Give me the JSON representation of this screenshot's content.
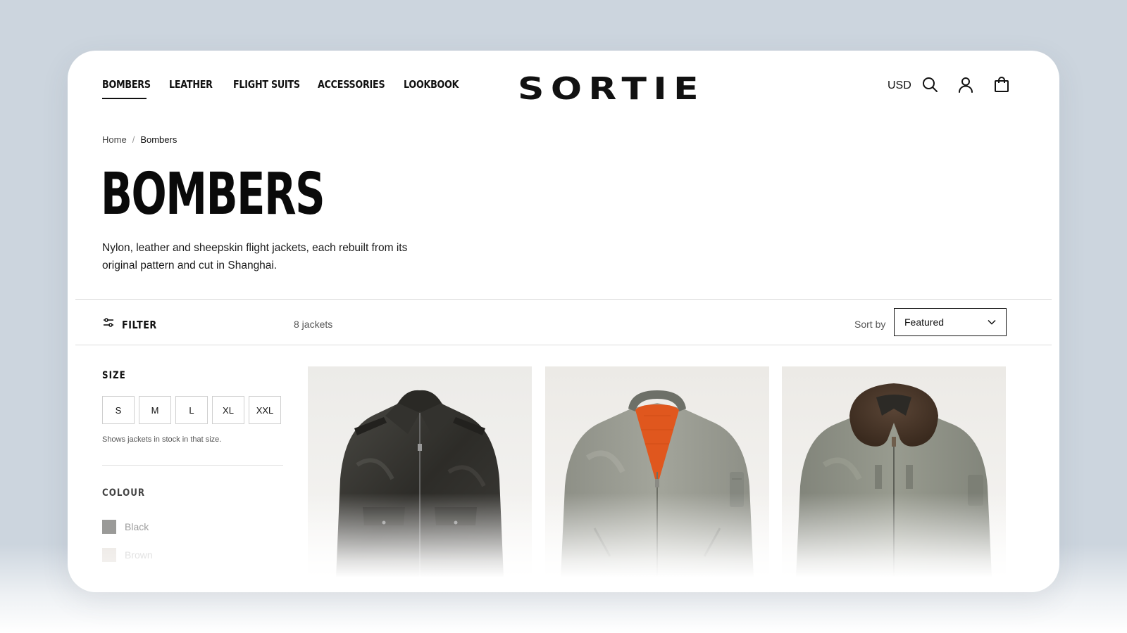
{
  "header": {
    "nav": [
      {
        "label": "BOMBERS",
        "active": true
      },
      {
        "label": "LEATHER",
        "active": false
      },
      {
        "label": "FLIGHT SUITS",
        "active": false
      },
      {
        "label": "ACCESSORIES",
        "active": false
      },
      {
        "label": "LOOKBOOK",
        "active": false
      }
    ],
    "logo": "SORTIE",
    "currency": "USD",
    "icons": [
      "search-icon",
      "account-icon",
      "bag-icon"
    ]
  },
  "breadcrumb": {
    "home": "Home",
    "separator": "/",
    "current": "Bombers"
  },
  "page": {
    "title": "BOMBERS",
    "description": "Nylon, leather and sheepskin flight jackets, each rebuilt from its original pattern and cut in Shanghai."
  },
  "toolbar": {
    "filter_label": "FILTER",
    "count": "8 jackets",
    "sort_label": "Sort by",
    "sort_value": "Featured"
  },
  "filters": {
    "size": {
      "heading": "SIZE",
      "options": [
        "S",
        "M",
        "L",
        "XL",
        "XXL"
      ],
      "note": "Shows jackets in stock in that size."
    },
    "colour": {
      "heading": "COLOUR",
      "options": [
        {
          "name": "Black",
          "swatch": "#9a9a98"
        },
        {
          "name": "Brown",
          "swatch": "#e8e4e0"
        }
      ]
    }
  },
  "products": [
    {
      "image": "dark leather A-2 style jacket with collar and flap pockets",
      "body_color": "#3a3a36",
      "lining_color": "#2a2a26"
    },
    {
      "image": "sage nylon MA-1 bomber with orange lining and sleeve pocket",
      "body_color": "#9a9c92",
      "lining_color": "#e0571e"
    },
    {
      "image": "sage nylon B-15 bomber with brown fur collar",
      "body_color": "#8e9184",
      "lining_color": "#4a3a2c"
    }
  ],
  "colors": {
    "text": "#111111",
    "background": "#ccd5de",
    "card": "#ffffff",
    "rule": "#dcdcdc"
  }
}
